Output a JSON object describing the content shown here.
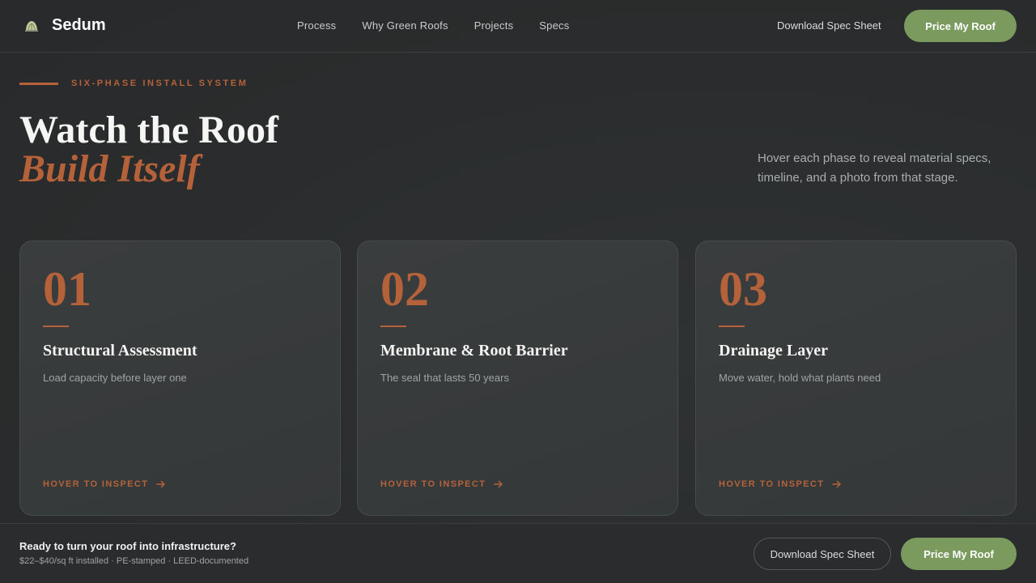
{
  "header": {
    "brand": "Sedum",
    "nav": [
      "Process",
      "Why Green Roofs",
      "Projects",
      "Specs"
    ],
    "download_label": "Download Spec Sheet",
    "price_label": "Price My Roof"
  },
  "hero": {
    "eyebrow": "SIX-PHASE INSTALL SYSTEM",
    "title_line1": "Watch the Roof",
    "title_line2": "Build Itself",
    "description": "Hover each phase to reveal material specs, timeline, and a photo from that stage."
  },
  "cards": [
    {
      "num": "01",
      "title": "Structural Assessment",
      "subtitle": "Load capacity before layer one",
      "cta": "HOVER TO INSPECT"
    },
    {
      "num": "02",
      "title": "Membrane & Root Barrier",
      "subtitle": "The seal that lasts 50 years",
      "cta": "HOVER TO INSPECT"
    },
    {
      "num": "03",
      "title": "Drainage Layer",
      "subtitle": "Move water, hold what plants need",
      "cta": "HOVER TO INSPECT"
    }
  ],
  "footer": {
    "title": "Ready to turn your roof into infrastructure?",
    "subtitle": "$22–$40/sq ft installed · PE-stamped · LEED-documented",
    "download_label": "Download Spec Sheet",
    "price_label": "Price My Roof"
  },
  "colors": {
    "accent": "#b5623a",
    "green": "#7a9a5e",
    "background": "#2b2d2e"
  },
  "icons": {
    "brand": "sedum-leaf-icon",
    "cta_arrow": "arrow-right-icon"
  }
}
